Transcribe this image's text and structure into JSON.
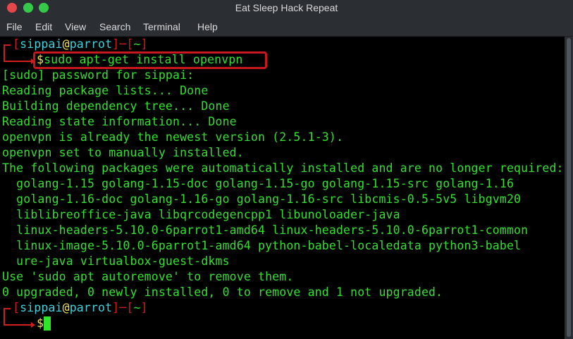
{
  "window": {
    "title": "Eat Sleep Hack Repeat"
  },
  "menu": [
    "File",
    "Edit",
    "View",
    "Search",
    "Terminal",
    "Help"
  ],
  "prompt1": {
    "open_bracket": "[",
    "user": "sippai",
    "at": "@",
    "host": "parrot",
    "close_bracket": "]",
    "dash": "─",
    "dir_open": "[",
    "dir": "~",
    "dir_close": "]",
    "symbol": "$",
    "command": "sudo apt-get install openvpn"
  },
  "output": [
    "[sudo] password for sippai:",
    "Reading package lists... Done",
    "Building dependency tree... Done",
    "Reading state information... Done",
    "openvpn is already the newest version (2.5.1-3).",
    "openvpn set to manually installed.",
    "The following packages were automatically installed and are no longer required:",
    "  golang-1.15 golang-1.15-doc golang-1.15-go golang-1.15-src golang-1.16",
    "  golang-1.16-doc golang-1.16-go golang-1.16-src libcmis-0.5-5v5 libgvm20",
    "  liblibreoffice-java libqrcodegencpp1 libunoloader-java",
    "  linux-headers-5.10.0-6parrot1-amd64 linux-headers-5.10.0-6parrot1-common",
    "  linux-image-5.10.0-6parrot1-amd64 python-babel-localedata python3-babel",
    "  ure-java virtualbox-guest-dkms",
    "Use 'sudo apt autoremove' to remove them.",
    "0 upgraded, 0 newly installed, 0 to remove and 1 not upgraded."
  ],
  "prompt2": {
    "open_bracket": "[",
    "user": "sippai",
    "at": "@",
    "host": "parrot",
    "close_bracket": "]",
    "dash": "─",
    "dir_open": "[",
    "dir": "~",
    "dir_close": "]",
    "symbol": "$",
    "command": ""
  },
  "colors": {
    "prompt_bracket": "#d01d1d",
    "user": "#3fd2dd",
    "at": "#f3e35a",
    "host": "#3fd2dd",
    "output": "#33e02f",
    "highlight": "#c9181d"
  }
}
